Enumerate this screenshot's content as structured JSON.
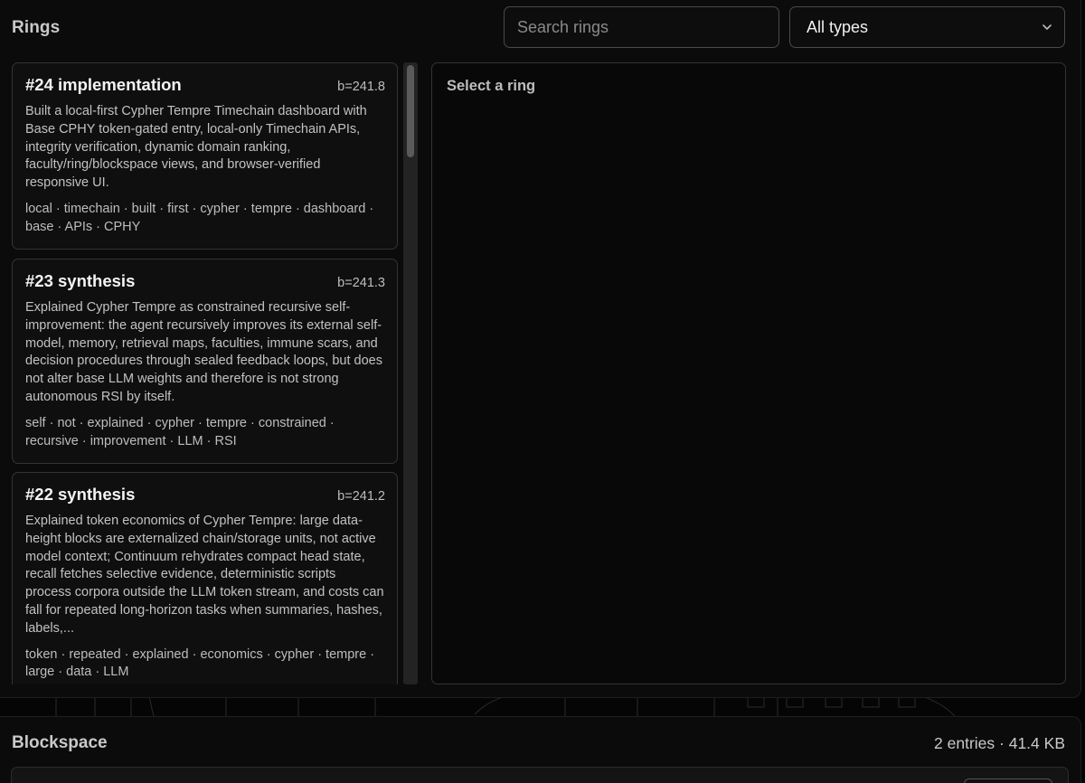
{
  "rings": {
    "title": "Rings",
    "search": {
      "placeholder": "Search rings",
      "value": ""
    },
    "type_filter": {
      "selected": "All types"
    },
    "list": [
      {
        "title": "#24 implementation",
        "b": "b=241.8",
        "body": "Built a local-first Cypher Tempre Timechain dashboard with Base CPHY token-gated entry, local-only Timechain APIs, integrity verification, dynamic domain ranking, faculty/ring/blockspace views, and browser-verified responsive UI.",
        "tags": "local · timechain · built · first · cypher · tempre · dashboard · base · APIs · CPHY"
      },
      {
        "title": "#23 synthesis",
        "b": "b=241.3",
        "body": "Explained Cypher Tempre as constrained recursive self-improvement: the agent recursively improves its external self-model, memory, retrieval maps, faculties, immune scars, and decision procedures through sealed feedback loops, but does not alter base LLM weights and therefore is not strong autonomous RSI by itself.",
        "tags": "self · not · explained · cypher · tempre · constrained · recursive · improvement · LLM · RSI"
      },
      {
        "title": "#22 synthesis",
        "b": "b=241.2",
        "body": "Explained token economics of Cypher Tempre: large data-height blocks are externalized chain/storage units, not active model context; Continuum rehydrates compact head state, recall fetches selective evidence, deterministic scripts process corpora outside the LLM token stream, and costs can fall for repeated long-horizon tasks when summaries, hashes, labels,...",
        "tags": "token · repeated · explained · economics · cypher · tempre · large · data · LLM"
      }
    ],
    "detail": {
      "placeholder": "Select a ring"
    }
  },
  "blockspace": {
    "title": "Blockspace",
    "meta": "2 entries · 41.4 KB"
  },
  "icons": {
    "select_chevron": "chevron-down-icon"
  }
}
